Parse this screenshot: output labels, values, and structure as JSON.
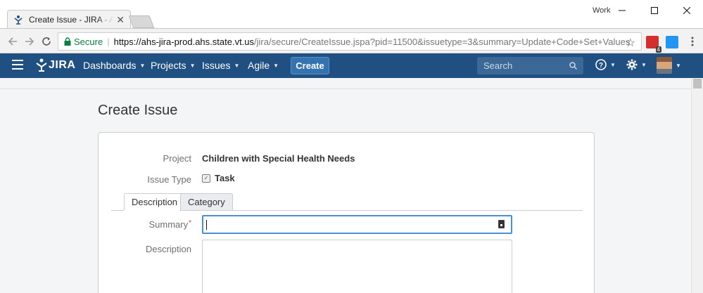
{
  "browser": {
    "tab_title": "Create Issue - JIRA - Agency of Human Services",
    "profile_label": "Work",
    "secure_label": "Secure",
    "url_host": "https://ahs-jira-prod.ahs.state.vt.us",
    "url_rest": "/jira/secure/CreateIssue.jspa?pid=11500&issuetype=3&summary=Update+Code+Set+Values",
    "extension_badge": "4"
  },
  "header": {
    "logo_text": "JIRA",
    "nav": [
      {
        "label": "Dashboards"
      },
      {
        "label": "Projects"
      },
      {
        "label": "Issues"
      },
      {
        "label": "Agile"
      }
    ],
    "create_label": "Create",
    "search_placeholder": "Search",
    "brand_color": "#205081"
  },
  "page": {
    "title": "Create Issue"
  },
  "form": {
    "project_label": "Project",
    "project_value": "Children with Special Health Needs",
    "issue_type_label": "Issue Type",
    "issue_type_value": "Task",
    "tabs": [
      {
        "label": "Description",
        "active": true
      },
      {
        "label": "Category",
        "active": false
      }
    ],
    "summary_label": "Summary",
    "summary_required_mark": "*",
    "summary_value": "",
    "description_label": "Description",
    "description_value": ""
  }
}
